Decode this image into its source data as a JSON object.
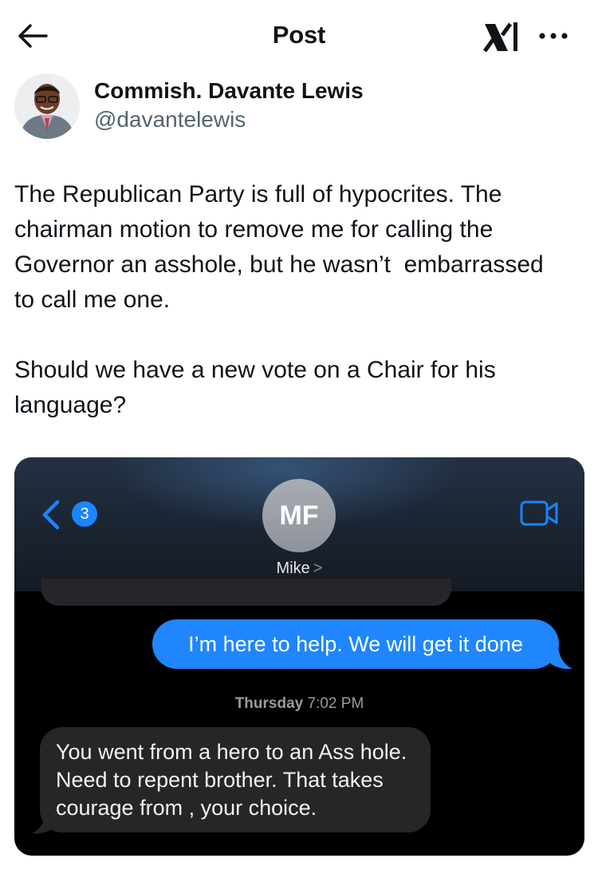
{
  "header": {
    "title": "Post",
    "back_icon": "arrow-left-icon",
    "logo_icon": "x-logo-icon",
    "more_icon": "more-dots-icon"
  },
  "author": {
    "display_name": "Commish. Davante Lewis",
    "handle": "@davantelewis"
  },
  "post": {
    "text": "The Republican Party is full of hypocrites. The\nchairman motion to remove me for calling the\nGovernor an asshole, but he wasn’t  embarrassed\nto call me one.\n\nShould we have a new vote on a Chair for his\nlanguage?"
  },
  "screenshot": {
    "back_badge": "3",
    "contact_initials": "MF",
    "contact_name": "Mike",
    "contact_chevron": ">",
    "video_icon": "video-camera-icon",
    "messages": [
      {
        "direction": "outgoing",
        "text": "I’m here to help. We will get it done"
      },
      {
        "direction": "incoming",
        "text": "You went from a hero to an Ass hole.\nNeed to repent brother. That takes\ncourage from , your choice."
      }
    ],
    "timestamp_day": "Thursday",
    "timestamp_time": "7:02 PM"
  },
  "colors": {
    "imessage_blue": "#1f86fd",
    "incoming_bubble": "#262629",
    "handle_gray": "#536471"
  }
}
